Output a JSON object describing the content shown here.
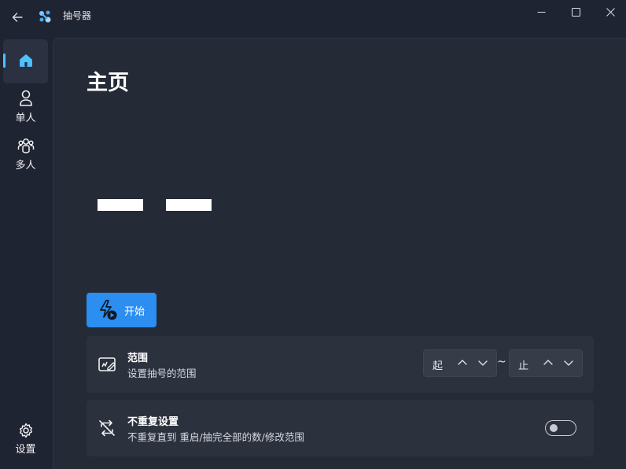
{
  "window": {
    "title": "抽号器",
    "colors": {
      "accent": "#2b8ef0",
      "indicator": "#4cc2ff",
      "background": "#1f2433",
      "content": "#252a37",
      "card": "#2c313e"
    },
    "icons": {
      "back": "arrow-left-icon",
      "app": "app-logo-icon",
      "minimize": "minimize-icon",
      "maximize": "maximize-icon",
      "close": "close-icon"
    }
  },
  "sidebar": {
    "items": [
      {
        "id": "home",
        "label": "",
        "icon": "home-icon",
        "selected": true
      },
      {
        "id": "single",
        "label": "单人",
        "icon": "person-icon"
      },
      {
        "id": "multi",
        "label": "多人",
        "icon": "people-icon"
      }
    ],
    "settings": {
      "label": "设置",
      "icon": "gear-icon"
    }
  },
  "main": {
    "title": "主页",
    "start_button": {
      "label": "开始",
      "icon": "flash-play-icon"
    },
    "range_card": {
      "title": "范围",
      "description": "设置抽号的范围",
      "icon": "range-edit-icon",
      "start_value": "起",
      "end_value": "止",
      "separator": "~"
    },
    "norepeat_card": {
      "title": "不重复设置",
      "description": "不重复直到 重启/抽完全部的数/修改范围",
      "icon": "repeat-off-icon",
      "toggle_on": false
    }
  }
}
